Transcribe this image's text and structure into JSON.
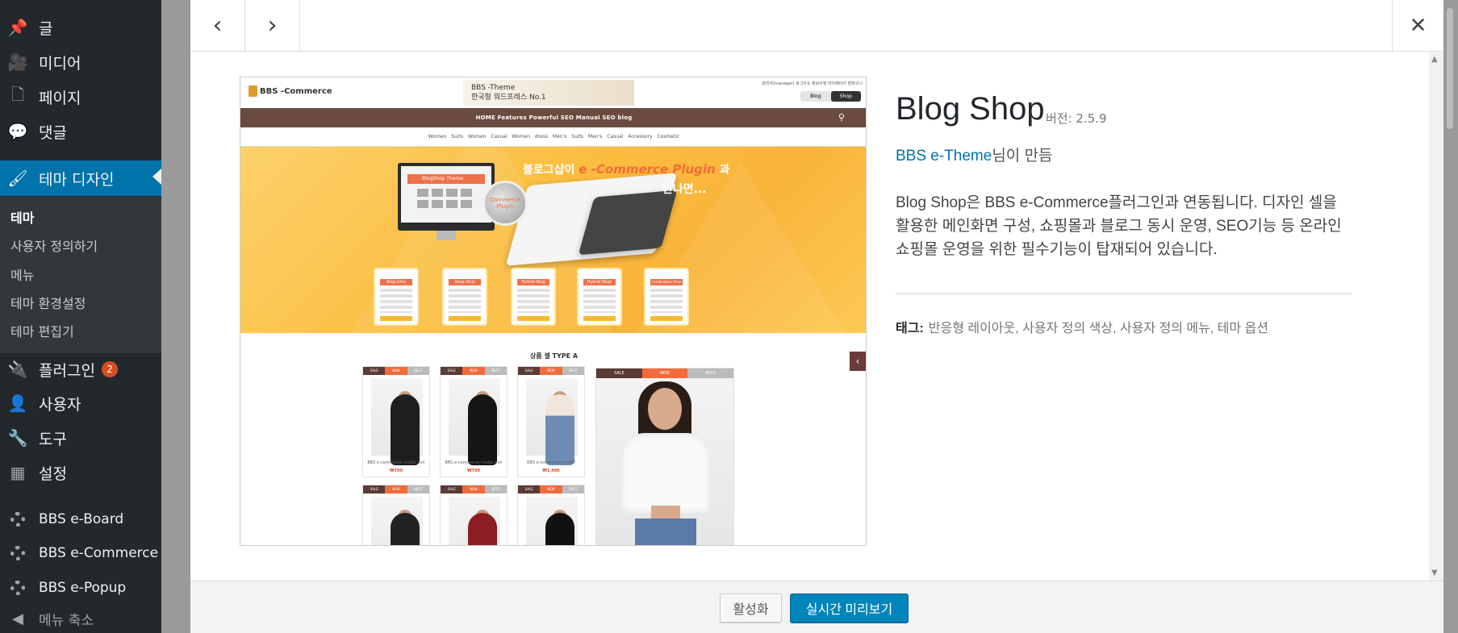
{
  "sidebar": {
    "items": [
      {
        "label": "글",
        "icon": "pin-icon"
      },
      {
        "label": "미디어",
        "icon": "media-icon"
      },
      {
        "label": "페이지",
        "icon": "page-icon"
      },
      {
        "label": "댓글",
        "icon": "comment-icon"
      },
      {
        "label": "테마 디자인",
        "icon": "brush-icon",
        "active": true
      },
      {
        "label": "플러그인",
        "icon": "plugin-icon",
        "badge": "2"
      },
      {
        "label": "사용자",
        "icon": "user-icon"
      },
      {
        "label": "도구",
        "icon": "wrench-icon"
      },
      {
        "label": "설정",
        "icon": "settings-icon"
      },
      {
        "label": "BBS e-Board",
        "icon": "gear-icon"
      },
      {
        "label": "BBS e-Commerce",
        "icon": "gear-icon"
      },
      {
        "label": "BBS e-Popup",
        "icon": "gear-icon"
      }
    ],
    "submenu": [
      "테마",
      "사용자 정의하기",
      "메뉴",
      "테마 환경설정",
      "테마 편집기"
    ],
    "collapse_label": "메뉴 축소",
    "accent": "#0073aa"
  },
  "modal": {
    "prev_symbol": "‹",
    "next_symbol": "›",
    "close_symbol": "✕"
  },
  "preview": {
    "logo": "BBS -Commerce",
    "banner_line1": "BBS -Theme",
    "banner_line2": "한국형 워드프레스 No.1",
    "top_links": "관리자(manager)  로그아웃  정보수정  마이페이지  장바구니",
    "toggle": [
      "Blog",
      "Shop"
    ],
    "nav": "HOME      Features      Powerful SEO      Manual      SEO blog",
    "categories": "Women Suits    Women Casual    Women dress    Men's Suits    Men's Casual    Accessory    Cosmetic",
    "hero_title_prefix": "블로그샵이",
    "hero_title_em": "e -Commerce Plugin",
    "hero_title_suffix": "과",
    "hero_subtitle": "만나면...",
    "monitor_label": "BlogShop Theme",
    "lens_label": "Commerce Plugin",
    "phones": [
      "Blog Only",
      "Shop Only",
      "Hybrid Blog",
      "Hybrid Shop",
      "Combination Shop & Blog"
    ],
    "section_title": "상품 셀 TYPE A",
    "product_tags": [
      "SALE",
      "NEW",
      "BEST"
    ],
    "products": [
      {
        "caption": "BBS e-commerce model mm",
        "price": "₩700"
      },
      {
        "caption": "BBS e-commerce model mm",
        "price": "₩700"
      },
      {
        "caption": "BBS e-commerce model",
        "price": "₩1,400"
      }
    ]
  },
  "theme": {
    "name": "Blog Shop",
    "version": "버전: 2.5.9",
    "author_link": "BBS e-Theme",
    "author_suffix": "님이 만듬",
    "description": "Blog Shop은 BBS e-Commerce플러그인과 연동됩니다. 디자인 셀을 활용한 메인화면 구성, 쇼핑몰과 블로그 동시 운영, SEO기능 등 온라인 쇼핑몰 운영을 위한 필수기능이 탑재되어 있습니다.",
    "tags_label": "태그:",
    "tags": "반응형 레이아웃, 사용자 정의 색상, 사용자 정의 메뉴, 테마 옵션"
  },
  "footer": {
    "activate_label": "활성화",
    "live_preview_label": "실시간 미리보기"
  }
}
